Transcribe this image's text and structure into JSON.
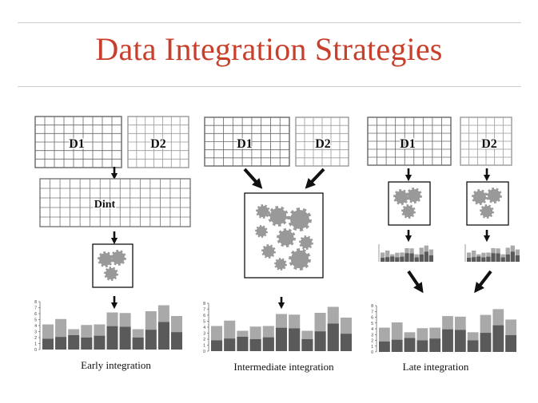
{
  "title": "Data Integration Strategies",
  "colors": {
    "title": "#c8402b",
    "gear": "#999999",
    "bar_total": "#a9a9a9",
    "bar_base": "#5a5a5a"
  },
  "panels": [
    {
      "id": "early",
      "caption": "Early integration",
      "matrices": [
        "D1",
        "D2"
      ],
      "integrated_matrix": "Dint"
    },
    {
      "id": "intermediate",
      "caption": "Intermediate integration",
      "matrices": [
        "D1",
        "D2"
      ]
    },
    {
      "id": "late",
      "caption": "Late integration",
      "matrices": [
        "D1",
        "D2"
      ]
    }
  ],
  "chart_data": {
    "type": "bar",
    "yticks": [
      "0",
      "1",
      "2",
      "3",
      "4",
      "5",
      "6",
      "7",
      "8"
    ],
    "ylim": [
      0,
      8
    ],
    "series": [
      {
        "values": [
          4.2,
          5.1,
          3.4,
          4.1,
          4.2,
          6.2,
          6.1,
          3.4,
          6.4,
          7.4,
          5.6
        ]
      },
      {
        "values": [
          1.8,
          2.1,
          2.4,
          2.0,
          2.3,
          3.9,
          3.8,
          2.0,
          3.3,
          4.6,
          2.9
        ]
      }
    ]
  }
}
